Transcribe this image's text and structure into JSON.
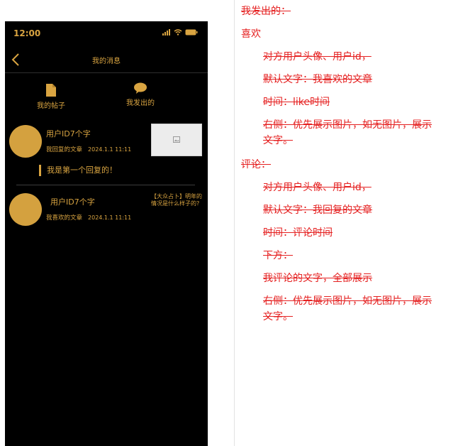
{
  "phone": {
    "status_time": "12:00",
    "nav_title": "我的消息",
    "tabs": [
      {
        "label": "我的帖子",
        "icon": "document-icon"
      },
      {
        "label": "我发出的",
        "icon": "chat-bubble-icon"
      }
    ],
    "messages": [
      {
        "username": "用户ID7个字",
        "action": "我回复的文章",
        "date": "2024.1.1 11:11",
        "reply": "我是第一个回复的！",
        "thumbnail": "image-placeholder-icon"
      },
      {
        "username": "用户ID7个字",
        "action": "我喜欢的文章",
        "date": "2024.1.1 11:11",
        "side_text": "【大众占卜】明年的情况是什么样子的?"
      }
    ]
  },
  "notes": [
    {
      "text": "我发出的：",
      "strike": true
    },
    {
      "text": "喜欢",
      "strike": false
    },
    {
      "text": "对方用户头像、用户id，",
      "strike": true
    },
    {
      "text": "默认文字：我喜欢的文章",
      "strike": true
    },
    {
      "text": "时间：like时间",
      "strike": true
    },
    {
      "text": "右侧：优先展示图片，如无图片，展示",
      "strike": true
    },
    {
      "text": "文字。",
      "strike": true
    },
    {
      "text": "评论：",
      "strike": true
    },
    {
      "text": "对方用户头像、用户id，",
      "strike": true
    },
    {
      "text": "默认文字：我回复的文章",
      "strike": true
    },
    {
      "text": "时间：评论时间",
      "strike": true
    },
    {
      "text": "下方：",
      "strike": true
    },
    {
      "text": "我评论的文字，全部展示",
      "strike": true
    },
    {
      "text": "右侧：优先展示图片，如无图片，展示",
      "strike": true
    },
    {
      "text": "文字。",
      "strike": true
    }
  ],
  "colors": {
    "phone_bg": "#000000",
    "accent_gold": "#d9a441",
    "avatar_gold": "#d4a13f",
    "note_red": "#e52020"
  }
}
